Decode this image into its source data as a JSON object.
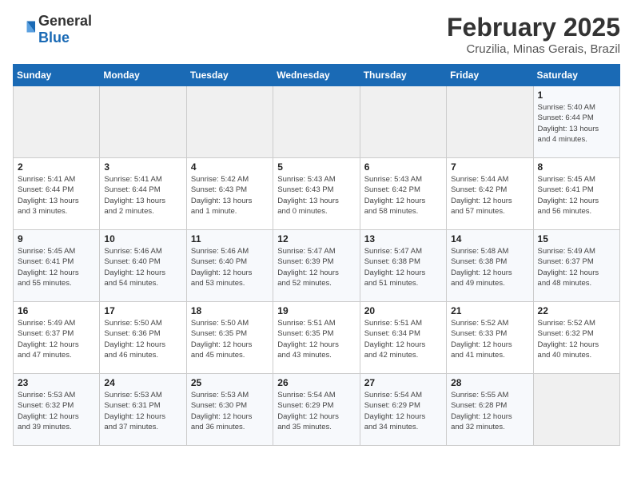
{
  "logo": {
    "general": "General",
    "blue": "Blue"
  },
  "header": {
    "month": "February 2025",
    "location": "Cruzilia, Minas Gerais, Brazil"
  },
  "weekdays": [
    "Sunday",
    "Monday",
    "Tuesday",
    "Wednesday",
    "Thursday",
    "Friday",
    "Saturday"
  ],
  "weeks": [
    [
      {
        "day": "",
        "info": ""
      },
      {
        "day": "",
        "info": ""
      },
      {
        "day": "",
        "info": ""
      },
      {
        "day": "",
        "info": ""
      },
      {
        "day": "",
        "info": ""
      },
      {
        "day": "",
        "info": ""
      },
      {
        "day": "1",
        "info": "Sunrise: 5:40 AM\nSunset: 6:44 PM\nDaylight: 13 hours\nand 4 minutes."
      }
    ],
    [
      {
        "day": "2",
        "info": "Sunrise: 5:41 AM\nSunset: 6:44 PM\nDaylight: 13 hours\nand 3 minutes."
      },
      {
        "day": "3",
        "info": "Sunrise: 5:41 AM\nSunset: 6:44 PM\nDaylight: 13 hours\nand 2 minutes."
      },
      {
        "day": "4",
        "info": "Sunrise: 5:42 AM\nSunset: 6:43 PM\nDaylight: 13 hours\nand 1 minute."
      },
      {
        "day": "5",
        "info": "Sunrise: 5:43 AM\nSunset: 6:43 PM\nDaylight: 13 hours\nand 0 minutes."
      },
      {
        "day": "6",
        "info": "Sunrise: 5:43 AM\nSunset: 6:42 PM\nDaylight: 12 hours\nand 58 minutes."
      },
      {
        "day": "7",
        "info": "Sunrise: 5:44 AM\nSunset: 6:42 PM\nDaylight: 12 hours\nand 57 minutes."
      },
      {
        "day": "8",
        "info": "Sunrise: 5:45 AM\nSunset: 6:41 PM\nDaylight: 12 hours\nand 56 minutes."
      }
    ],
    [
      {
        "day": "9",
        "info": "Sunrise: 5:45 AM\nSunset: 6:41 PM\nDaylight: 12 hours\nand 55 minutes."
      },
      {
        "day": "10",
        "info": "Sunrise: 5:46 AM\nSunset: 6:40 PM\nDaylight: 12 hours\nand 54 minutes."
      },
      {
        "day": "11",
        "info": "Sunrise: 5:46 AM\nSunset: 6:40 PM\nDaylight: 12 hours\nand 53 minutes."
      },
      {
        "day": "12",
        "info": "Sunrise: 5:47 AM\nSunset: 6:39 PM\nDaylight: 12 hours\nand 52 minutes."
      },
      {
        "day": "13",
        "info": "Sunrise: 5:47 AM\nSunset: 6:38 PM\nDaylight: 12 hours\nand 51 minutes."
      },
      {
        "day": "14",
        "info": "Sunrise: 5:48 AM\nSunset: 6:38 PM\nDaylight: 12 hours\nand 49 minutes."
      },
      {
        "day": "15",
        "info": "Sunrise: 5:49 AM\nSunset: 6:37 PM\nDaylight: 12 hours\nand 48 minutes."
      }
    ],
    [
      {
        "day": "16",
        "info": "Sunrise: 5:49 AM\nSunset: 6:37 PM\nDaylight: 12 hours\nand 47 minutes."
      },
      {
        "day": "17",
        "info": "Sunrise: 5:50 AM\nSunset: 6:36 PM\nDaylight: 12 hours\nand 46 minutes."
      },
      {
        "day": "18",
        "info": "Sunrise: 5:50 AM\nSunset: 6:35 PM\nDaylight: 12 hours\nand 45 minutes."
      },
      {
        "day": "19",
        "info": "Sunrise: 5:51 AM\nSunset: 6:35 PM\nDaylight: 12 hours\nand 43 minutes."
      },
      {
        "day": "20",
        "info": "Sunrise: 5:51 AM\nSunset: 6:34 PM\nDaylight: 12 hours\nand 42 minutes."
      },
      {
        "day": "21",
        "info": "Sunrise: 5:52 AM\nSunset: 6:33 PM\nDaylight: 12 hours\nand 41 minutes."
      },
      {
        "day": "22",
        "info": "Sunrise: 5:52 AM\nSunset: 6:32 PM\nDaylight: 12 hours\nand 40 minutes."
      }
    ],
    [
      {
        "day": "23",
        "info": "Sunrise: 5:53 AM\nSunset: 6:32 PM\nDaylight: 12 hours\nand 39 minutes."
      },
      {
        "day": "24",
        "info": "Sunrise: 5:53 AM\nSunset: 6:31 PM\nDaylight: 12 hours\nand 37 minutes."
      },
      {
        "day": "25",
        "info": "Sunrise: 5:53 AM\nSunset: 6:30 PM\nDaylight: 12 hours\nand 36 minutes."
      },
      {
        "day": "26",
        "info": "Sunrise: 5:54 AM\nSunset: 6:29 PM\nDaylight: 12 hours\nand 35 minutes."
      },
      {
        "day": "27",
        "info": "Sunrise: 5:54 AM\nSunset: 6:29 PM\nDaylight: 12 hours\nand 34 minutes."
      },
      {
        "day": "28",
        "info": "Sunrise: 5:55 AM\nSunset: 6:28 PM\nDaylight: 12 hours\nand 32 minutes."
      },
      {
        "day": "",
        "info": ""
      }
    ]
  ]
}
